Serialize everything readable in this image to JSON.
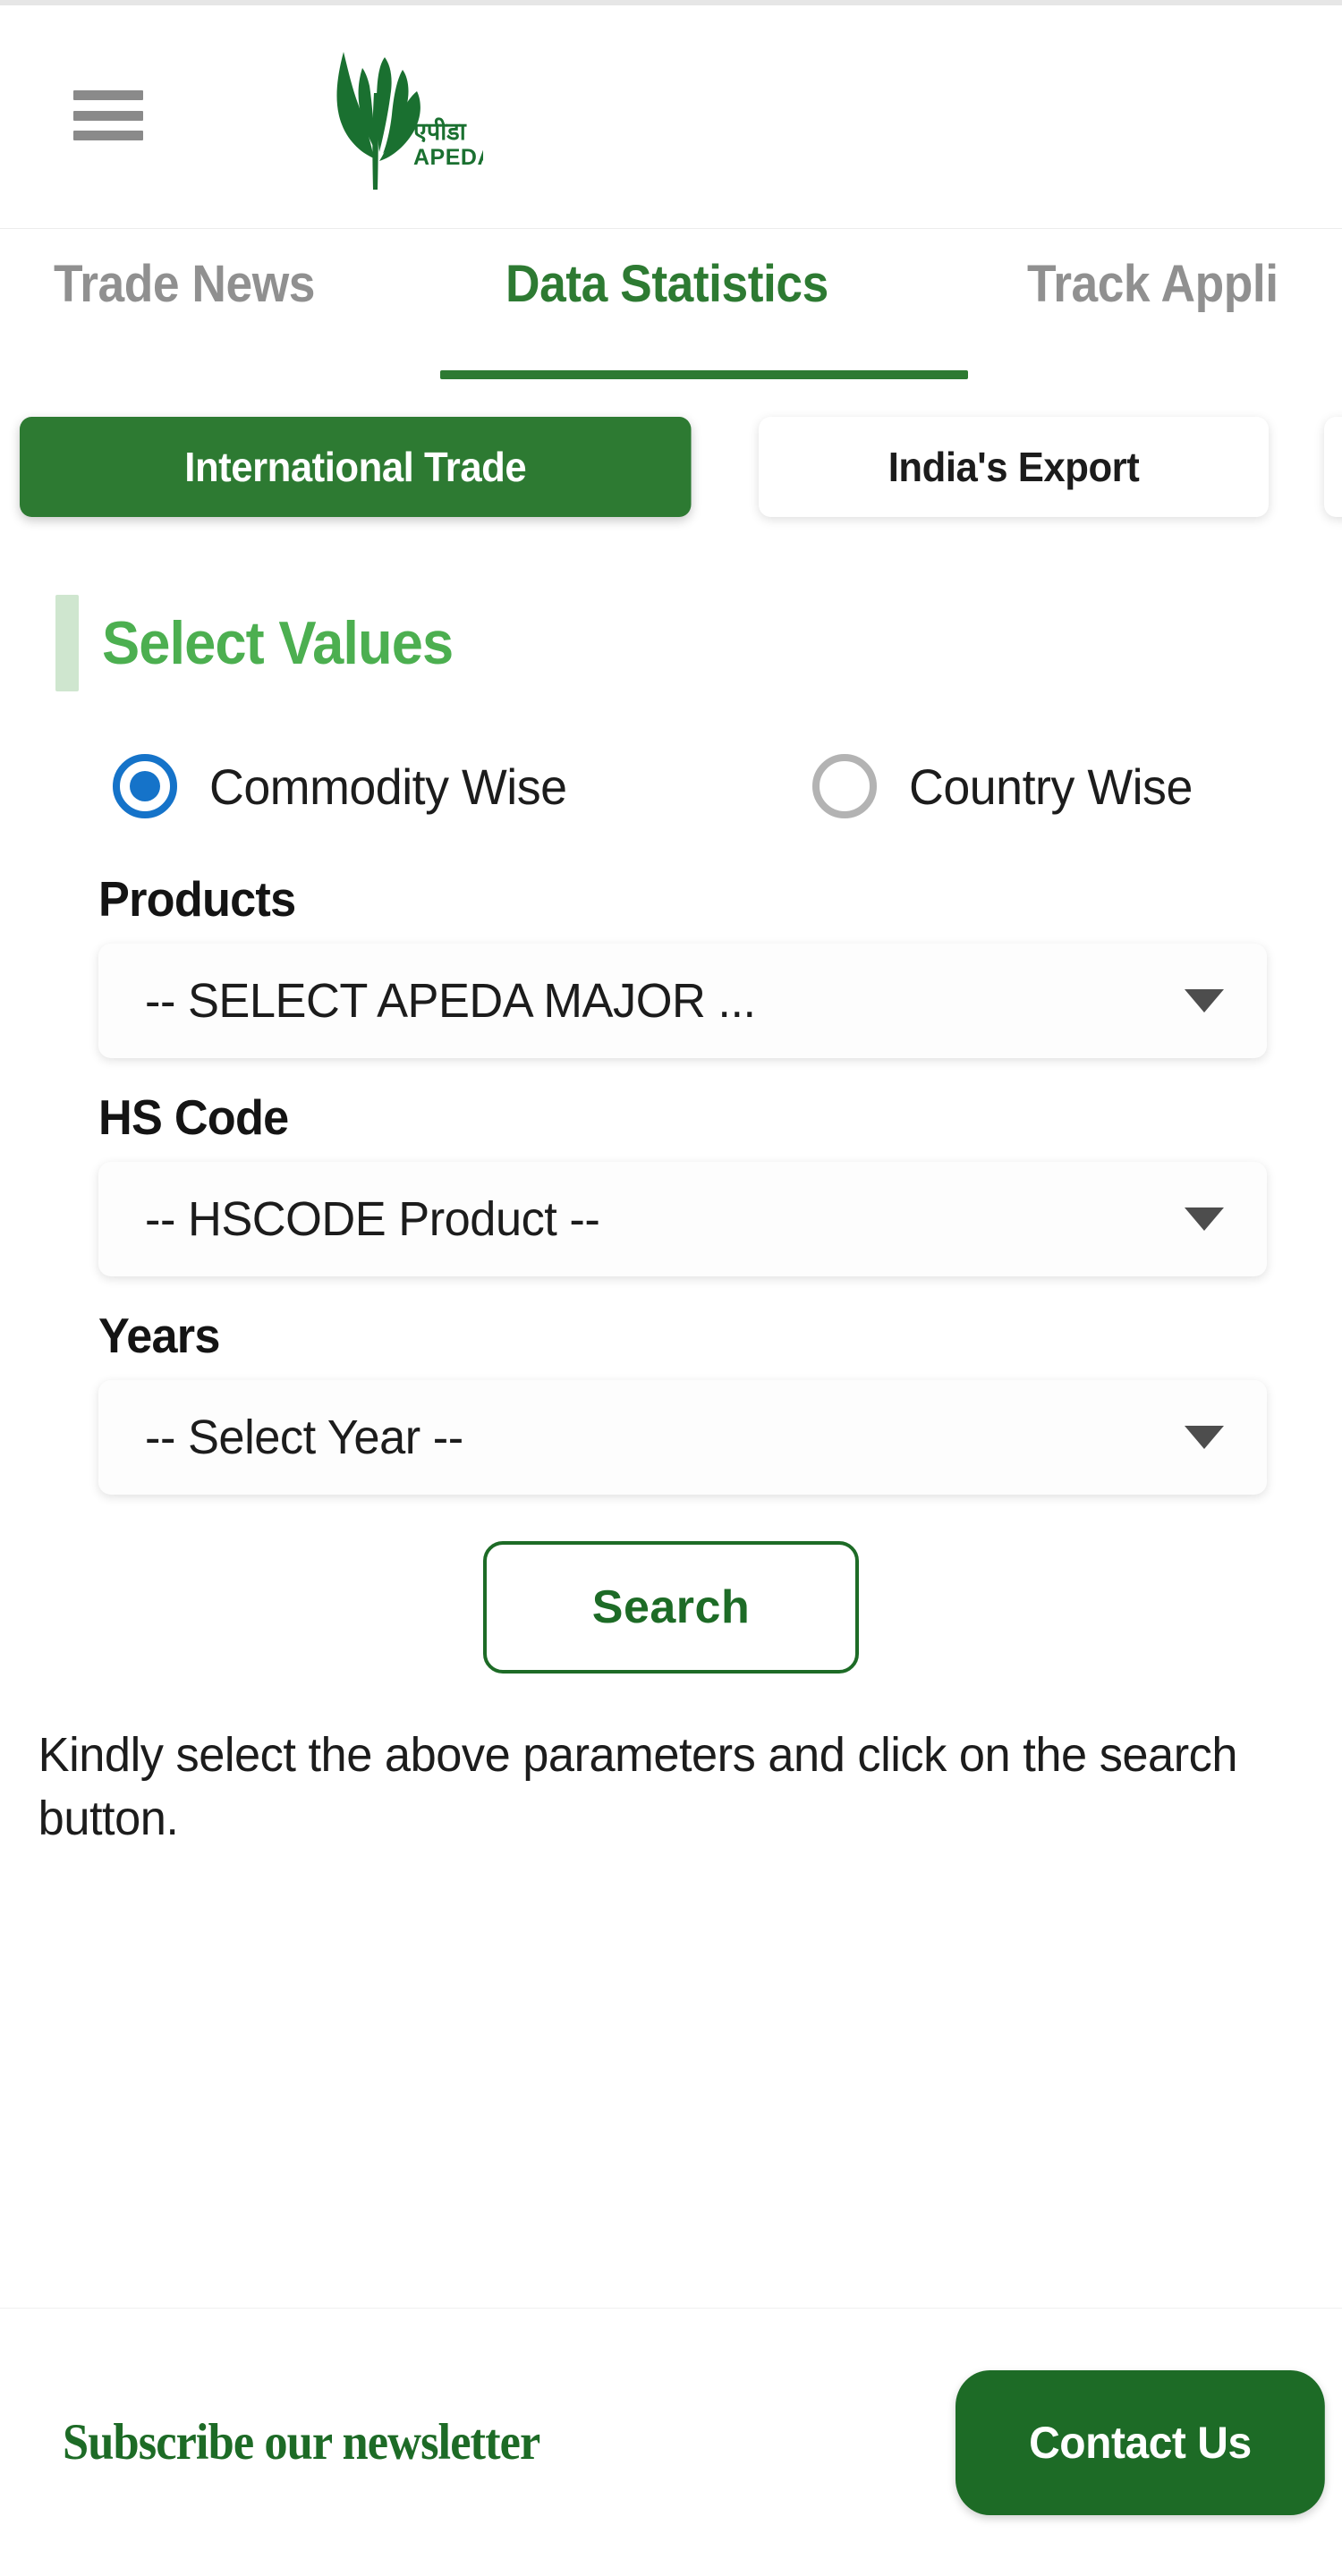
{
  "header": {
    "menu_icon": "hamburger-menu-icon",
    "logo": {
      "icon": "apeda-leaf-logo-icon",
      "hindi_text": "एपीडा",
      "english_text": "APEDA"
    }
  },
  "nav": {
    "tabs": [
      {
        "label": "Trade News",
        "active": false
      },
      {
        "label": "Data Statistics",
        "active": true
      },
      {
        "label": "Track Appli",
        "active": false
      }
    ]
  },
  "subtabs": {
    "items": [
      {
        "label": "International Trade",
        "active": true
      },
      {
        "label": "India's Export",
        "active": false
      },
      {
        "label": "",
        "active": false
      }
    ]
  },
  "panel": {
    "title": "Select Values",
    "radio_group": {
      "options": [
        {
          "label": "Commodity Wise",
          "checked": true
        },
        {
          "label": "Country Wise",
          "checked": false
        }
      ]
    },
    "fields": [
      {
        "label": "Products",
        "value": "-- SELECT APEDA MAJOR ...",
        "caret": "chevron-down-icon"
      },
      {
        "label": "HS Code",
        "value": "-- HSCODE Product --",
        "caret": "chevron-down-icon"
      },
      {
        "label": "Years",
        "value": "-- Select Year --",
        "caret": "chevron-down-icon"
      }
    ],
    "search_button": "Search",
    "note": "Kindly select the above parameters and click on the search button."
  },
  "footer": {
    "newsletter_label": "Subscribe our newsletter",
    "contact_label": "Contact Us"
  },
  "colors": {
    "brand_green": "#2d7a32",
    "dark_green": "#1d6b26",
    "light_green": "#4caf50",
    "accent_blue": "#1573c9",
    "muted_gray": "#909090"
  }
}
